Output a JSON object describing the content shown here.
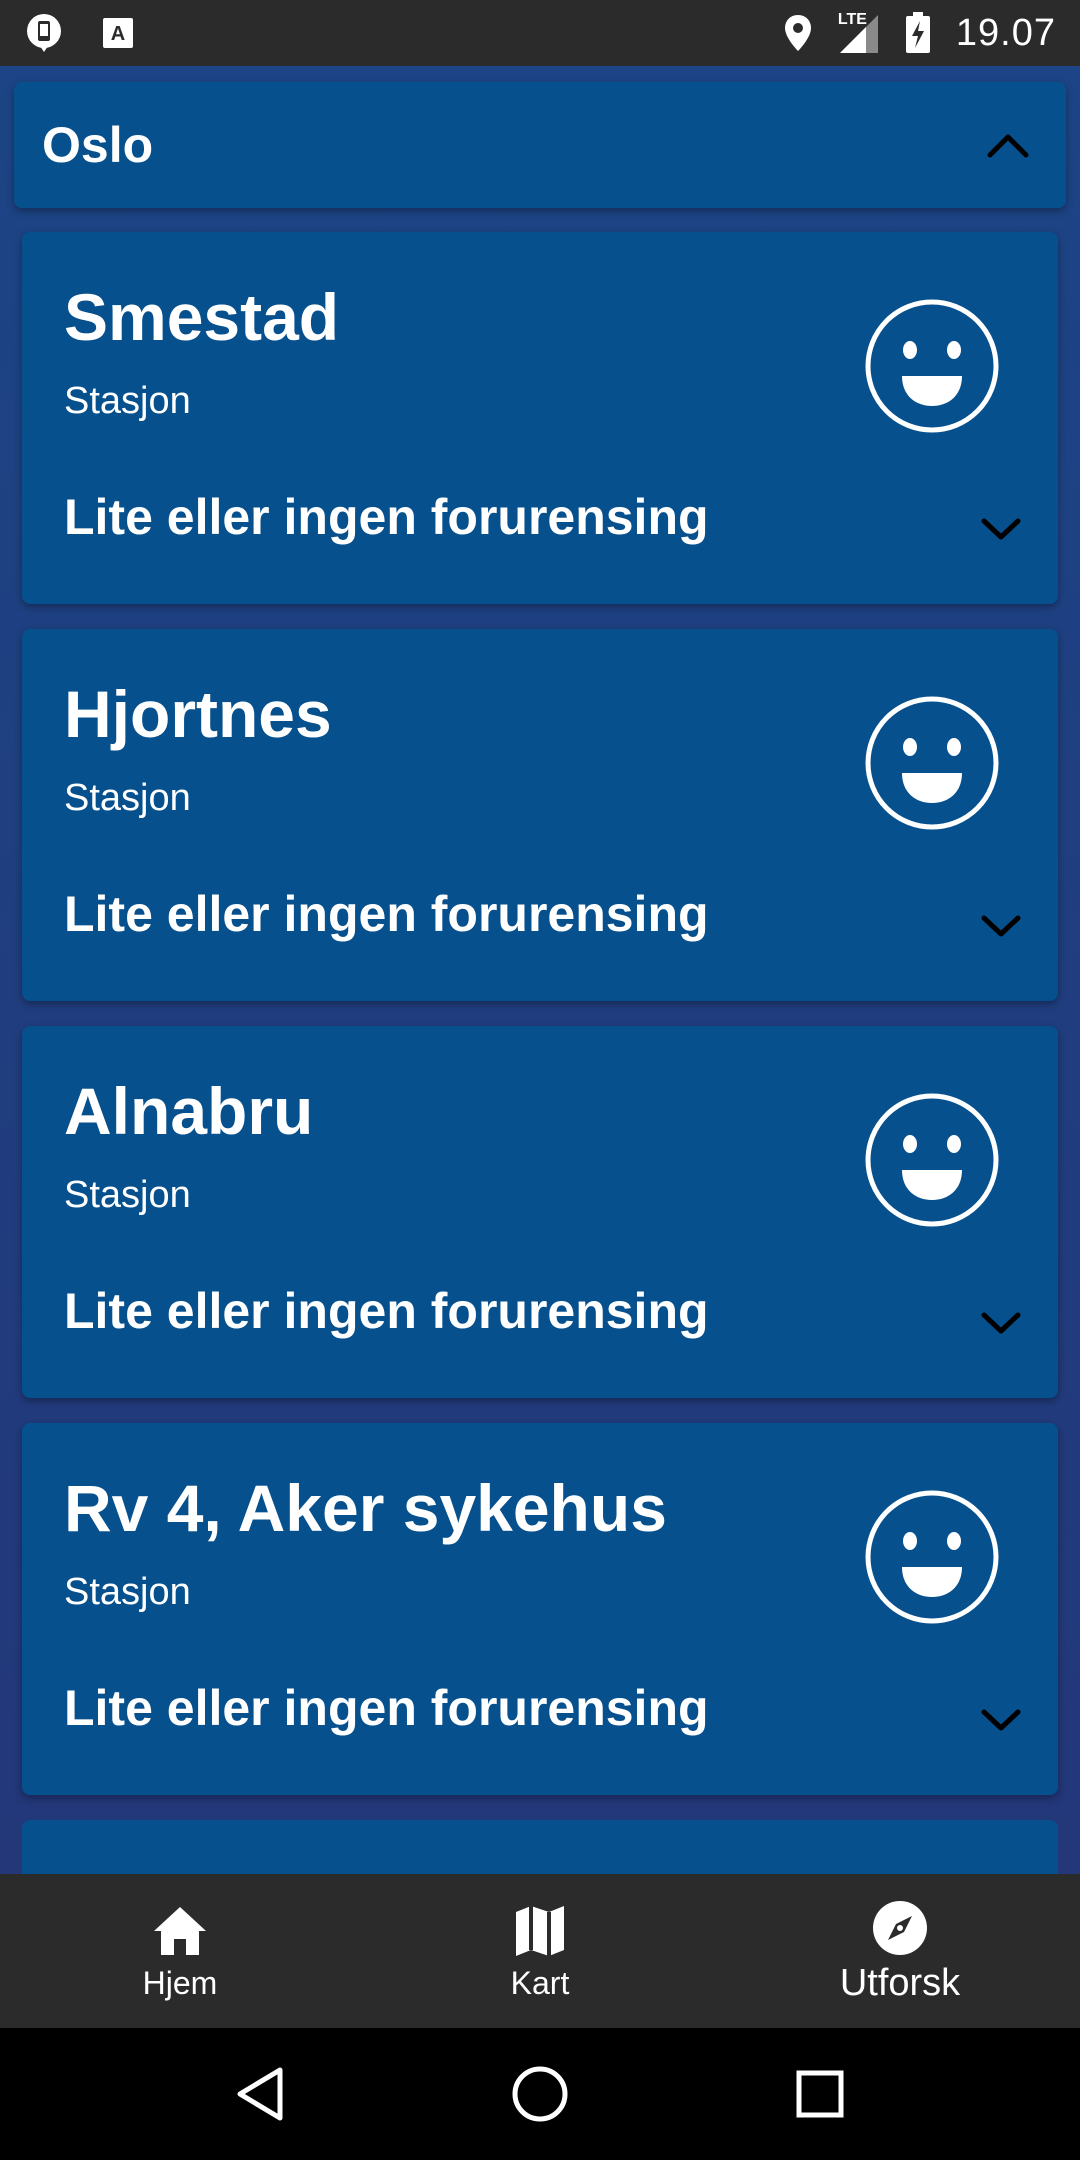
{
  "status_bar": {
    "time": "19.07",
    "network": "LTE",
    "left_icons": [
      "notification-app-icon",
      "keyboard-a-icon"
    ],
    "right_icons": [
      "location-pin-icon",
      "signal-icon",
      "battery-charging-icon"
    ]
  },
  "region": {
    "title": "Oslo",
    "expanded": true
  },
  "stations": [
    {
      "name": "Smestad",
      "type": "Stasjon",
      "status": "Lite eller ingen forurensing",
      "level_icon": "happy-face-icon"
    },
    {
      "name": "Hjortnes",
      "type": "Stasjon",
      "status": "Lite eller ingen forurensing",
      "level_icon": "happy-face-icon"
    },
    {
      "name": "Alnabru",
      "type": "Stasjon",
      "status": "Lite eller ingen forurensing",
      "level_icon": "happy-face-icon"
    },
    {
      "name": "Rv 4, Aker sykehus",
      "type": "Stasjon",
      "status": "Lite eller ingen forurensing",
      "level_icon": "happy-face-icon"
    }
  ],
  "bottom_nav": {
    "items": [
      {
        "label": "Hjem",
        "icon": "home-icon",
        "active": false
      },
      {
        "label": "Kart",
        "icon": "map-icon",
        "active": false
      },
      {
        "label": "Utforsk",
        "icon": "compass-icon",
        "active": true
      }
    ]
  },
  "system_nav": [
    "back-icon",
    "home-circle-icon",
    "recents-icon"
  ],
  "colors": {
    "background": "#1c4586",
    "card": "#06508d",
    "bars": "#2b2b2b",
    "text": "#ffffff"
  }
}
